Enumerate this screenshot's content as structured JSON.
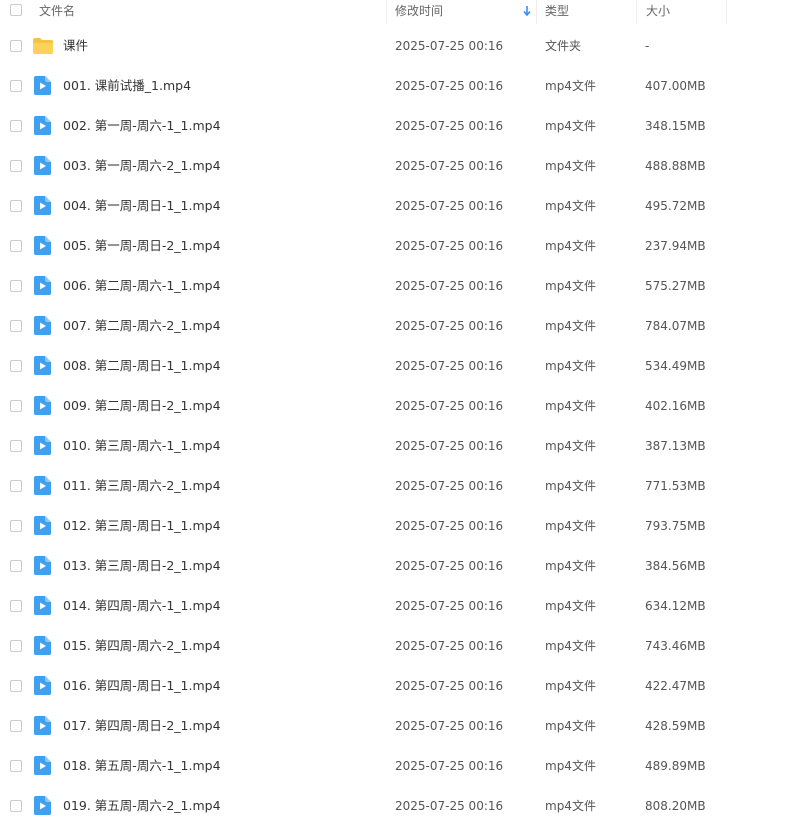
{
  "header": {
    "name_label": "文件名",
    "time_label": "修改时间",
    "type_label": "类型",
    "size_label": "大小",
    "sort_icon": "arrow-down-icon"
  },
  "icons": {
    "folder": "folder-icon",
    "video": "video-file-icon",
    "folder_color": "#f6c343",
    "video_color": "#3f9ff2"
  },
  "rows": [
    {
      "kind": "folder",
      "name": "课件",
      "time": "2025-07-25 00:16",
      "type": "文件夹",
      "size": "-"
    },
    {
      "kind": "video",
      "name": "001. 课前试播_1.mp4",
      "time": "2025-07-25 00:16",
      "type": "mp4文件",
      "size": "407.00MB"
    },
    {
      "kind": "video",
      "name": "002. 第一周-周六-1_1.mp4",
      "time": "2025-07-25 00:16",
      "type": "mp4文件",
      "size": "348.15MB"
    },
    {
      "kind": "video",
      "name": "003. 第一周-周六-2_1.mp4",
      "time": "2025-07-25 00:16",
      "type": "mp4文件",
      "size": "488.88MB"
    },
    {
      "kind": "video",
      "name": "004. 第一周-周日-1_1.mp4",
      "time": "2025-07-25 00:16",
      "type": "mp4文件",
      "size": "495.72MB"
    },
    {
      "kind": "video",
      "name": "005. 第一周-周日-2_1.mp4",
      "time": "2025-07-25 00:16",
      "type": "mp4文件",
      "size": "237.94MB"
    },
    {
      "kind": "video",
      "name": "006. 第二周-周六-1_1.mp4",
      "time": "2025-07-25 00:16",
      "type": "mp4文件",
      "size": "575.27MB"
    },
    {
      "kind": "video",
      "name": "007. 第二周-周六-2_1.mp4",
      "time": "2025-07-25 00:16",
      "type": "mp4文件",
      "size": "784.07MB"
    },
    {
      "kind": "video",
      "name": "008. 第二周-周日-1_1.mp4",
      "time": "2025-07-25 00:16",
      "type": "mp4文件",
      "size": "534.49MB"
    },
    {
      "kind": "video",
      "name": "009. 第二周-周日-2_1.mp4",
      "time": "2025-07-25 00:16",
      "type": "mp4文件",
      "size": "402.16MB"
    },
    {
      "kind": "video",
      "name": "010. 第三周-周六-1_1.mp4",
      "time": "2025-07-25 00:16",
      "type": "mp4文件",
      "size": "387.13MB"
    },
    {
      "kind": "video",
      "name": "011. 第三周-周六-2_1.mp4",
      "time": "2025-07-25 00:16",
      "type": "mp4文件",
      "size": "771.53MB"
    },
    {
      "kind": "video",
      "name": "012. 第三周-周日-1_1.mp4",
      "time": "2025-07-25 00:16",
      "type": "mp4文件",
      "size": "793.75MB"
    },
    {
      "kind": "video",
      "name": "013. 第三周-周日-2_1.mp4",
      "time": "2025-07-25 00:16",
      "type": "mp4文件",
      "size": "384.56MB"
    },
    {
      "kind": "video",
      "name": "014. 第四周-周六-1_1.mp4",
      "time": "2025-07-25 00:16",
      "type": "mp4文件",
      "size": "634.12MB"
    },
    {
      "kind": "video",
      "name": "015. 第四周-周六-2_1.mp4",
      "time": "2025-07-25 00:16",
      "type": "mp4文件",
      "size": "743.46MB"
    },
    {
      "kind": "video",
      "name": "016. 第四周-周日-1_1.mp4",
      "time": "2025-07-25 00:16",
      "type": "mp4文件",
      "size": "422.47MB"
    },
    {
      "kind": "video",
      "name": "017. 第四周-周日-2_1.mp4",
      "time": "2025-07-25 00:16",
      "type": "mp4文件",
      "size": "428.59MB"
    },
    {
      "kind": "video",
      "name": "018. 第五周-周六-1_1.mp4",
      "time": "2025-07-25 00:16",
      "type": "mp4文件",
      "size": "489.89MB"
    },
    {
      "kind": "video",
      "name": "019. 第五周-周六-2_1.mp4",
      "time": "2025-07-25 00:16",
      "type": "mp4文件",
      "size": "808.20MB"
    }
  ]
}
